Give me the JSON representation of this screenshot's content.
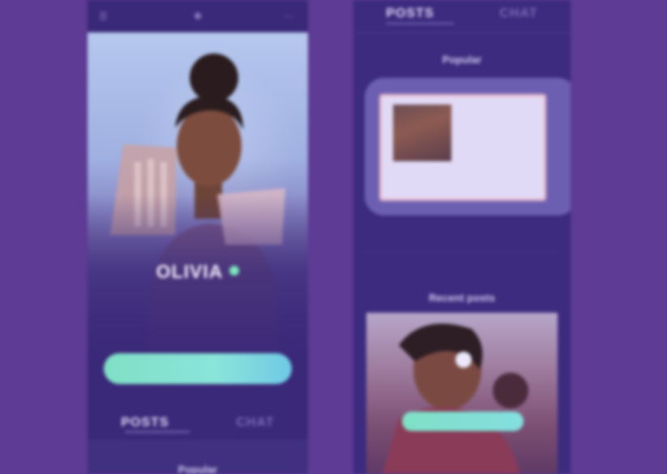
{
  "left_phone": {
    "menu_icon": "menu-icon",
    "logo_icon": "app-logo-icon",
    "more_icon": "more-icon",
    "profile_name": "OLIVIA",
    "verified_icon": "verified-badge-icon",
    "bio": "",
    "stats": "",
    "follow_button": "",
    "tabs": [
      {
        "label": "POSTS",
        "active": true
      },
      {
        "label": "CHAT",
        "active": false
      }
    ],
    "feed_title": "Popular"
  },
  "right_phone": {
    "tabs": [
      {
        "label": "POSTS",
        "active": true
      },
      {
        "label": "CHAT",
        "active": false
      }
    ],
    "popular_title": "Popular",
    "popular_card": {
      "title": "",
      "meta": "",
      "caption": ""
    },
    "strip_items": [
      "",
      "",
      ""
    ],
    "recent_title": "Recent posts",
    "recent_button": ""
  },
  "colors": {
    "background": "#5e3b94",
    "phone": "#3a2878",
    "accent": "#7fe0c6"
  }
}
